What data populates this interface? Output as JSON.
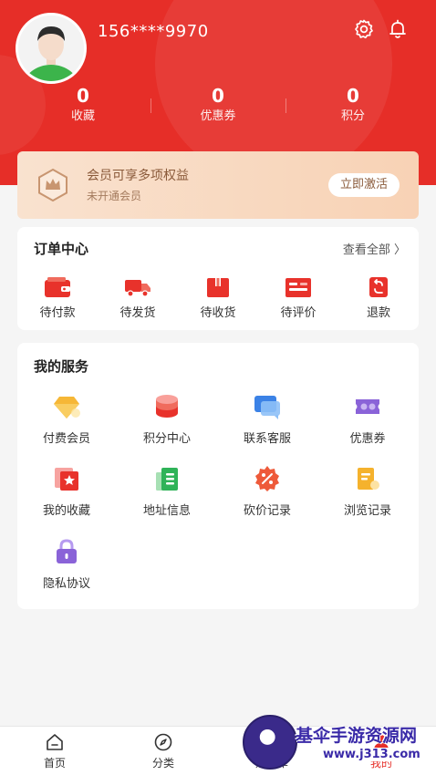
{
  "profile": {
    "phone": "156****9970"
  },
  "stats": [
    {
      "value": "0",
      "label": "收藏"
    },
    {
      "value": "0",
      "label": "优惠券"
    },
    {
      "value": "0",
      "label": "积分"
    }
  ],
  "vip": {
    "title": "会员可享多项权益",
    "subtitle": "未开通会员",
    "button": "立即激活"
  },
  "orders": {
    "title": "订单中心",
    "view_all": "查看全部",
    "items": [
      {
        "label": "待付款",
        "icon": "wallet-icon"
      },
      {
        "label": "待发货",
        "icon": "delivery-truck-icon"
      },
      {
        "label": "待收货",
        "icon": "package-box-icon"
      },
      {
        "label": "待评价",
        "icon": "review-card-icon"
      },
      {
        "label": "退款",
        "icon": "refund-icon"
      }
    ]
  },
  "services": {
    "title": "我的服务",
    "items": [
      {
        "label": "付费会员",
        "icon": "diamond-icon"
      },
      {
        "label": "积分中心",
        "icon": "coin-stack-icon"
      },
      {
        "label": "联系客服",
        "icon": "chat-bubble-icon"
      },
      {
        "label": "优惠券",
        "icon": "coupon-icon"
      },
      {
        "label": "我的收藏",
        "icon": "star-card-icon"
      },
      {
        "label": "地址信息",
        "icon": "address-book-icon"
      },
      {
        "label": "砍价记录",
        "icon": "discount-badge-icon"
      },
      {
        "label": "浏览记录",
        "icon": "history-doc-icon"
      },
      {
        "label": "隐私协议",
        "icon": "lock-icon"
      }
    ]
  },
  "tabbar": [
    {
      "label": "首页",
      "icon": "home-icon"
    },
    {
      "label": "分类",
      "icon": "compass-icon"
    },
    {
      "label": "购物车",
      "icon": "cart-icon"
    },
    {
      "label": "我的",
      "icon": "user-icon",
      "active": true
    }
  ],
  "watermark": {
    "title": "基伞手游资源网",
    "url": "www.j313.com"
  },
  "colors": {
    "brand_red": "#e62e28",
    "vip_gold": "#8a5a3a"
  }
}
